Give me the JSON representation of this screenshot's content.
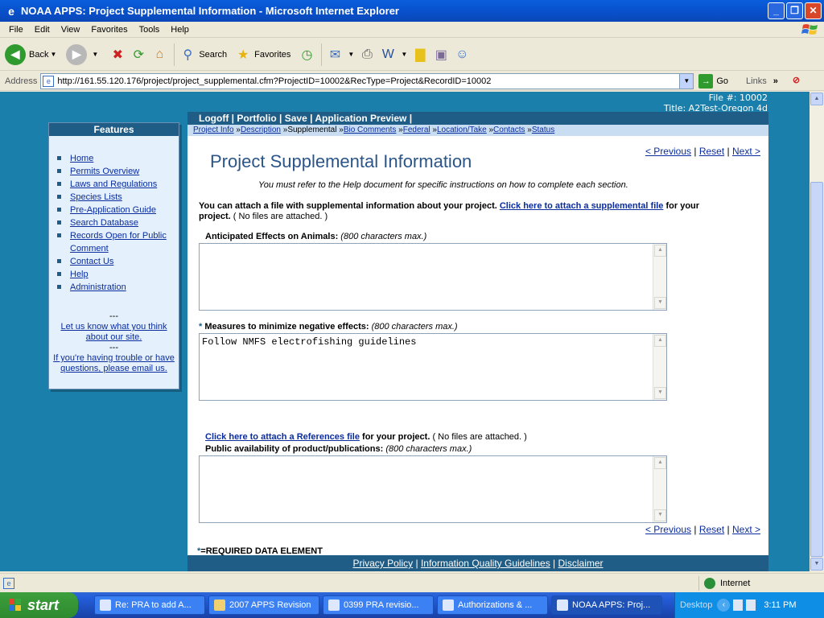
{
  "window": {
    "title": "NOAA APPS: Project Supplemental Information - Microsoft Internet Explorer"
  },
  "menu": [
    "File",
    "Edit",
    "View",
    "Favorites",
    "Tools",
    "Help"
  ],
  "toolbar": {
    "back": "Back",
    "search": "Search",
    "favorites": "Favorites"
  },
  "address": {
    "label": "Address",
    "url": "http://161.55.120.176/project/project_supplemental.cfm?ProjectID=10002&RecType=Project&RecordID=10002",
    "go": "Go",
    "links": "Links"
  },
  "fileinfo": {
    "file": "File #: 10002",
    "title": "Title: A2Test-Oregon 4d"
  },
  "sidebar": {
    "heading": "Features",
    "items": [
      "Home",
      "Permits Overview",
      "Laws and Regulations",
      "Species Lists",
      "Pre-Application Guide",
      "Search Database",
      "Records Open for Public Comment",
      "Contact Us",
      "Help",
      "Administration"
    ],
    "sep": "---",
    "feedback": "Let us know what you think about our site.",
    "trouble": "If you're having trouble or have questions, please email us."
  },
  "topnav": {
    "logoff": "Logoff",
    "portfolio": "Portfolio",
    "save": "Save",
    "preview": "Application Preview",
    "divider": "|"
  },
  "subnav": {
    "project_info": "Project Info",
    "description": "Description",
    "supplemental": "Supplemental",
    "bio_comments": "Bio Comments",
    "federal": "Federal",
    "location_take": "Location/Take",
    "contacts": "Contacts",
    "status": "Status",
    "marker": "»"
  },
  "page": {
    "title": "Project Supplemental Information",
    "previous": "< Previous",
    "reset": "Reset",
    "next": "Next >",
    "divider": "|",
    "instruction": "You must refer to the Help document for specific instructions on how to complete each section.",
    "attach_intro": "You can attach a file with supplemental information about your project.",
    "attach_link": "Click here to attach a supplemental file",
    "attach_tail": "for your project.",
    "no_files": "( No files are attached. )",
    "field1_label": "Anticipated Effects on Animals:",
    "field1_value": "",
    "maxchars": "(800 characters max.)",
    "req_star": "*",
    "field2_label": "Measures to minimize negative effects:",
    "field2_value": "Follow NMFS electrofishing guidelines",
    "ref_link": "Click here to attach a References file",
    "ref_tail": "for your project.",
    "field3_label": "Public availability of product/publications:",
    "field3_value": "",
    "required_note": "=REQUIRED DATA ELEMENT"
  },
  "footer": {
    "privacy": "Privacy Policy",
    "quality": "Information Quality Guidelines",
    "disclaimer": "Disclaimer",
    "divider": "|"
  },
  "status": {
    "zone": "Internet"
  },
  "taskbar": {
    "start": "start",
    "tasks": [
      "Re: PRA to add A...",
      "2007 APPS Revision",
      "0399 PRA revisio...",
      "Authorizations & ...",
      "NOAA APPS: Proj..."
    ],
    "desktop": "Desktop",
    "clock": "3:11 PM"
  },
  "colors": {
    "page_bg": "#1A80AB",
    "nav_bar": "#1F5D86",
    "link": "#0B2D9E",
    "title_text": "#2B5588"
  }
}
